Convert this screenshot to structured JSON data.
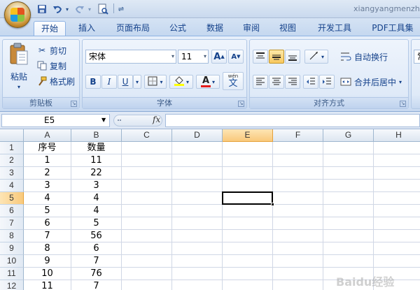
{
  "window": {
    "title": "xiangyangmenzhong"
  },
  "tabs": [
    "开始",
    "插入",
    "页面布局",
    "公式",
    "数据",
    "审阅",
    "视图",
    "开发工具",
    "PDF工具集"
  ],
  "ribbon": {
    "clipboard": {
      "label": "剪贴板",
      "paste": "粘贴",
      "cut": "剪切",
      "copy": "复制",
      "format_painter": "格式刷"
    },
    "font": {
      "label": "字体",
      "font_name": "宋体",
      "font_size": "11",
      "grow": "A",
      "shrink": "A",
      "bold": "B",
      "italic": "I",
      "underline": "U",
      "font_color_glyph": "A",
      "phonetic": "文",
      "phonetic_top": "wén"
    },
    "alignment": {
      "label": "对齐方式",
      "wrap_text": "自动换行",
      "merge_center": "合并后居中"
    },
    "number": {
      "partial": "常"
    }
  },
  "formula_bar": {
    "name_box": "E5",
    "fx": "fx",
    "content": ""
  },
  "sheet": {
    "columns": [
      "A",
      "B",
      "C",
      "D",
      "E",
      "F",
      "G",
      "H"
    ],
    "selected_column": "E",
    "selected_row": "5",
    "rows": [
      {
        "num": "1",
        "a": "序号",
        "b": "数量"
      },
      {
        "num": "2",
        "a": "1",
        "b": "11"
      },
      {
        "num": "3",
        "a": "2",
        "b": "22"
      },
      {
        "num": "4",
        "a": "3",
        "b": "3"
      },
      {
        "num": "5",
        "a": "4",
        "b": "4"
      },
      {
        "num": "6",
        "a": "5",
        "b": "4"
      },
      {
        "num": "7",
        "a": "6",
        "b": "5"
      },
      {
        "num": "8",
        "a": "7",
        "b": "56"
      },
      {
        "num": "9",
        "a": "8",
        "b": "6"
      },
      {
        "num": "10",
        "a": "9",
        "b": "7"
      },
      {
        "num": "11",
        "a": "10",
        "b": "76"
      },
      {
        "num": "12",
        "a": "11",
        "b": "7"
      }
    ]
  },
  "watermark": "Baidu经验",
  "colors": {
    "accent": "#15428b",
    "selected_header": "#f9c97b",
    "ribbon_bg": "#dbe7f6"
  },
  "icons": [
    "office-logo-icon",
    "save-icon",
    "undo-icon",
    "redo-icon",
    "print-preview-icon",
    "paste-icon",
    "scissors-icon",
    "copy-icon",
    "format-painter-icon",
    "border-icon",
    "fill-color-icon",
    "wrap-text-icon",
    "merge-icon",
    "fx-icon"
  ]
}
